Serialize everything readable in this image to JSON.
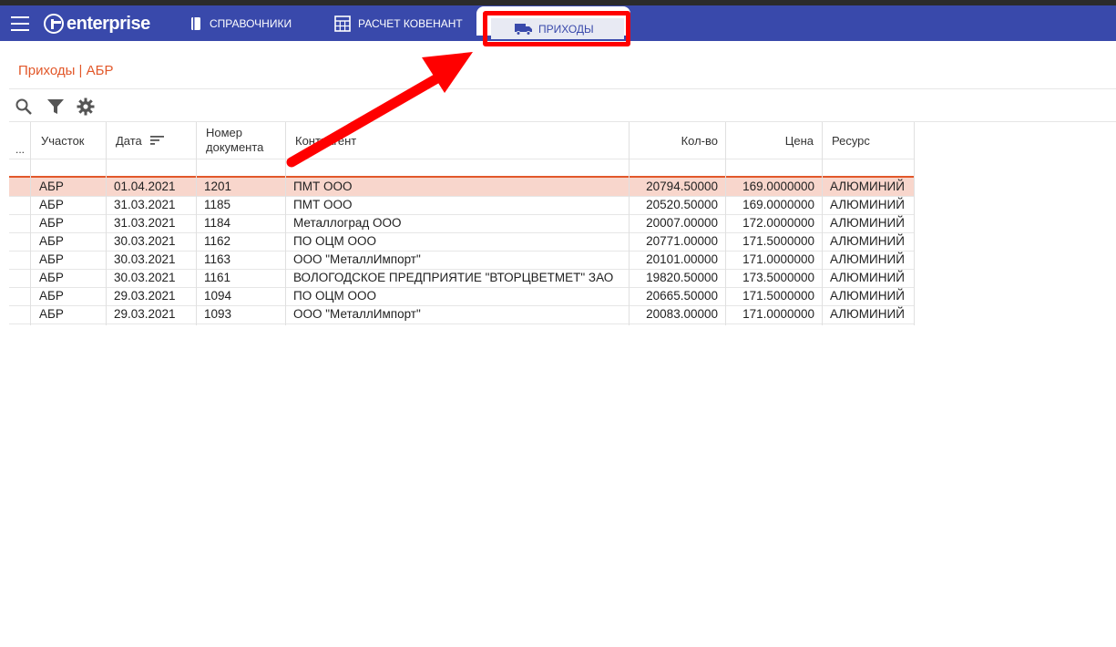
{
  "app": {
    "logo_text": "enterprise"
  },
  "nav": {
    "tabs": [
      {
        "label": "СПРАВОЧНИКИ",
        "icon": "book-icon"
      },
      {
        "label": "РАСЧЕТ КОВЕНАНТ",
        "icon": "calculator-icon"
      },
      {
        "label": "ПРИХОДЫ",
        "icon": "truck-icon",
        "active": true
      }
    ]
  },
  "page": {
    "title": "Приходы | АБР"
  },
  "toolbar": {
    "icons": [
      "search-icon",
      "filter-icon",
      "gear-icon"
    ]
  },
  "table": {
    "row_menu": "...",
    "headers": [
      "Участок",
      "Дата",
      "Номер документа",
      "Контрагент",
      "Кол-во",
      "Цена",
      "Ресурс"
    ],
    "rows": [
      [
        "АБР",
        "01.04.2021",
        "1201",
        "ПМТ ООО",
        "20794.50000",
        "169.0000000",
        "АЛЮМИНИЙ"
      ],
      [
        "АБР",
        "31.03.2021",
        "1185",
        "ПМТ ООО",
        "20520.50000",
        "169.0000000",
        "АЛЮМИНИЙ"
      ],
      [
        "АБР",
        "31.03.2021",
        "1184",
        "Металлоград ООО",
        "20007.00000",
        "172.0000000",
        "АЛЮМИНИЙ"
      ],
      [
        "АБР",
        "30.03.2021",
        "1162",
        "ПО ОЦМ ООО",
        "20771.00000",
        "171.5000000",
        "АЛЮМИНИЙ"
      ],
      [
        "АБР",
        "30.03.2021",
        "1163",
        "ООО \"МеталлИмпорт\"",
        "20101.00000",
        "171.0000000",
        "АЛЮМИНИЙ"
      ],
      [
        "АБР",
        "30.03.2021",
        "1161",
        "ВОЛОГОДСКОЕ ПРЕДПРИЯТИЕ \"ВТОРЦВЕТМЕТ\" ЗАО",
        "19820.50000",
        "173.5000000",
        "АЛЮМИНИЙ"
      ],
      [
        "АБР",
        "29.03.2021",
        "1094",
        "ПО ОЦМ ООО",
        "20665.50000",
        "171.5000000",
        "АЛЮМИНИЙ"
      ],
      [
        "АБР",
        "29.03.2021",
        "1093",
        "ООО \"МеталлИмпорт\"",
        "20083.00000",
        "171.0000000",
        "АЛЮМИНИЙ"
      ]
    ],
    "selected_row": 0
  },
  "colors": {
    "nav": "#3949ab",
    "accent": "#e2582a",
    "selected_row": "#f8d6cc",
    "highlight": "#ff0000"
  }
}
